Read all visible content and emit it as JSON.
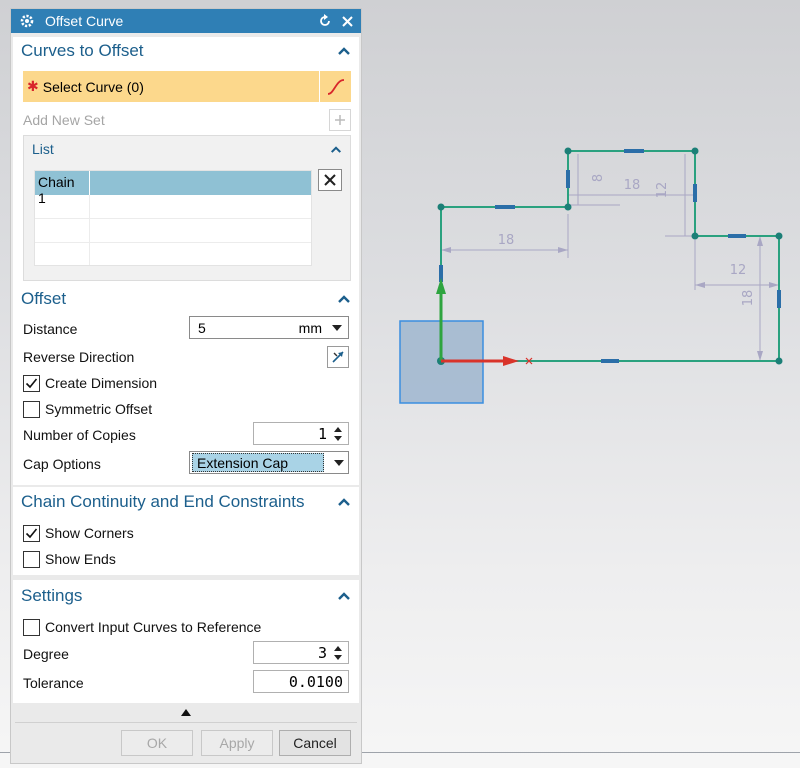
{
  "dialog": {
    "title": "Offset Curve"
  },
  "curves_to_offset": {
    "header": "Curves to Offset",
    "required_marker": "✱",
    "select_curve_label": "Select Curve (0)",
    "add_new_set_label": "Add New Set",
    "list_header": "List",
    "list_rows": [
      {
        "name": "Chain 1",
        "value": ""
      },
      {
        "name": "",
        "value": ""
      },
      {
        "name": "",
        "value": ""
      },
      {
        "name": "",
        "value": ""
      }
    ]
  },
  "offset": {
    "header": "Offset",
    "distance_label": "Distance",
    "distance_value": "5",
    "distance_unit": "mm",
    "reverse_direction_label": "Reverse Direction",
    "create_dimension_label": "Create Dimension",
    "create_dimension_checked": true,
    "symmetric_offset_label": "Symmetric Offset",
    "symmetric_offset_checked": false,
    "copies_label": "Number of Copies",
    "copies_value": "1",
    "cap_label": "Cap Options",
    "cap_value": "Extension Cap"
  },
  "chain": {
    "header": "Chain Continuity and End Constraints",
    "show_corners_label": "Show Corners",
    "show_corners_checked": true,
    "show_ends_label": "Show Ends",
    "show_ends_checked": false
  },
  "settings": {
    "header": "Settings",
    "convert_label": "Convert Input Curves to Reference",
    "convert_checked": false,
    "degree_label": "Degree",
    "degree_value": "3",
    "tolerance_label": "Tolerance",
    "tolerance_value": "0.0100"
  },
  "footer": {
    "ok_label": "OK",
    "apply_label": "Apply",
    "cancel_label": "Cancel"
  },
  "viewport": {
    "dimensions": [
      "8",
      "18",
      "12",
      "18",
      "12",
      "18"
    ],
    "colors": {
      "curve": "#2aa17f",
      "dimension": "#a9a7c4",
      "node": "#1c7f77",
      "constraint": "#2b6ea8",
      "triad_x": "#d9332a",
      "triad_y": "#2ea43f",
      "triad_box": "#9fb6cf"
    }
  }
}
